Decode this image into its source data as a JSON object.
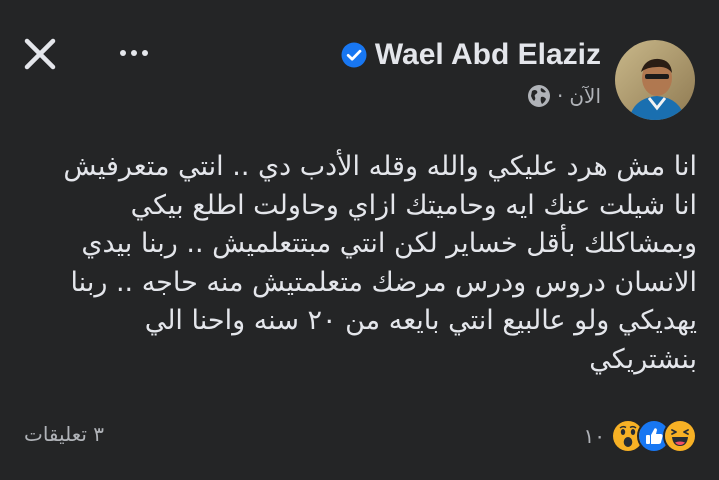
{
  "post": {
    "author": {
      "name": "Wael Abd Elaziz",
      "verified": true
    },
    "meta": {
      "time": "الآن",
      "separator": "·",
      "privacy_icon": "globe-icon"
    },
    "text_lines": [
      "انا مش هرد عليكي والله وقله الأدب دي .. انتي متعرفيش",
      "انا شيلت عنك ايه وحاميتك ازاي وحاولت اطلع بيكي",
      "وبمشاكلك بأقل خساير لكن انتي مبتتعلميش .. ربنا بيدي",
      "الانسان دروس ودرس مرضك متعلمتيش منه حاجه .. ربنا",
      "يهديكي ولو عالبيع انتي بايعه من ٢٠ سنه واحنا الي",
      "بنشتريكي"
    ],
    "footer": {
      "comments_label": "٣ تعليقات",
      "reactions_count": "١٠",
      "reactions": [
        "haha-icon",
        "like-icon",
        "wow-icon"
      ]
    }
  },
  "colors": {
    "background": "#242526",
    "text_primary": "#e4e6eb",
    "text_secondary": "#b0b3b8",
    "verified_blue": "#1877f2",
    "like_blue": "#1877f2",
    "reaction_yellow": "#f7b125"
  }
}
